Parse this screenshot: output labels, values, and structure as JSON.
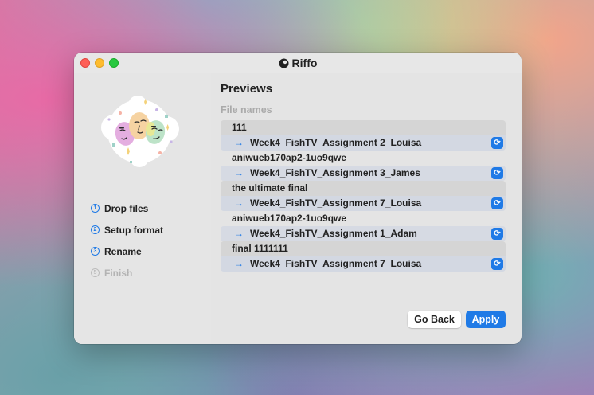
{
  "app": {
    "title": "Riffo"
  },
  "sidebar": {
    "steps": [
      {
        "num": "1",
        "label": "Drop files",
        "state": "done"
      },
      {
        "num": "2",
        "label": "Setup format",
        "state": "done"
      },
      {
        "num": "3",
        "label": "Rename",
        "state": "done"
      },
      {
        "num": "5",
        "label": "Finish",
        "state": "disabled"
      }
    ]
  },
  "main": {
    "heading": "Previews",
    "subheading": "File names",
    "files": [
      {
        "original": "111",
        "renamed": "Week4_FishTV_Assignment 2_Louisa"
      },
      {
        "original": "aniwueb170ap2-1uo9qwe",
        "renamed": "Week4_FishTV_Assignment 3_James"
      },
      {
        "original": "the ultimate final",
        "renamed": "Week4_FishTV_Assignment 7_Louisa"
      },
      {
        "original": "aniwueb170ap2-1uo9qwe",
        "renamed": "Week4_FishTV_Assignment 1_Adam"
      },
      {
        "original": "final 1111111",
        "renamed": "Week4_FishTV_Assignment 7_Louisa"
      }
    ]
  },
  "buttons": {
    "back": "Go Back",
    "apply": "Apply"
  },
  "colors": {
    "accent": "#1f7ae6"
  },
  "icons": {
    "arrow": "→",
    "refresh": "refresh-icon"
  }
}
